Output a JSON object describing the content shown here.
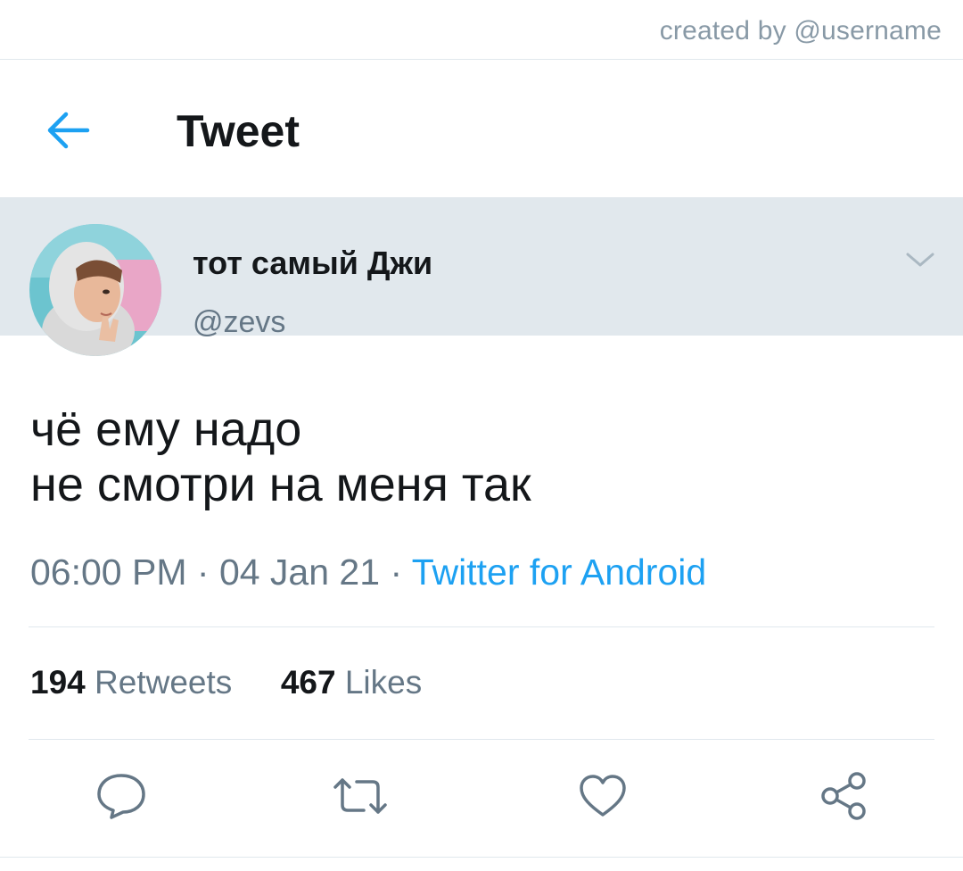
{
  "watermark": "created by @username",
  "header": {
    "title": "Tweet"
  },
  "author": {
    "display_name": "тот самый Джи",
    "handle": "@zevs"
  },
  "tweet": {
    "lines": [
      "чё ему надо",
      "не смотри на меня так"
    ],
    "time": "06:00 PM",
    "separator": " · ",
    "date": "04 Jan 21",
    "source": "Twitter for Android"
  },
  "stats": {
    "retweets_count": "194",
    "retweets_label": "Retweets",
    "likes_count": "467",
    "likes_label": "Likes"
  },
  "icons": {
    "back": "arrow-left-icon",
    "caret": "chevron-down-icon",
    "reply": "reply-icon",
    "retweet": "retweet-icon",
    "like": "heart-icon",
    "share": "share-icon"
  },
  "colors": {
    "accent": "#1da1f2",
    "text": "#14171a",
    "muted": "#657786",
    "icon": "#657786"
  }
}
